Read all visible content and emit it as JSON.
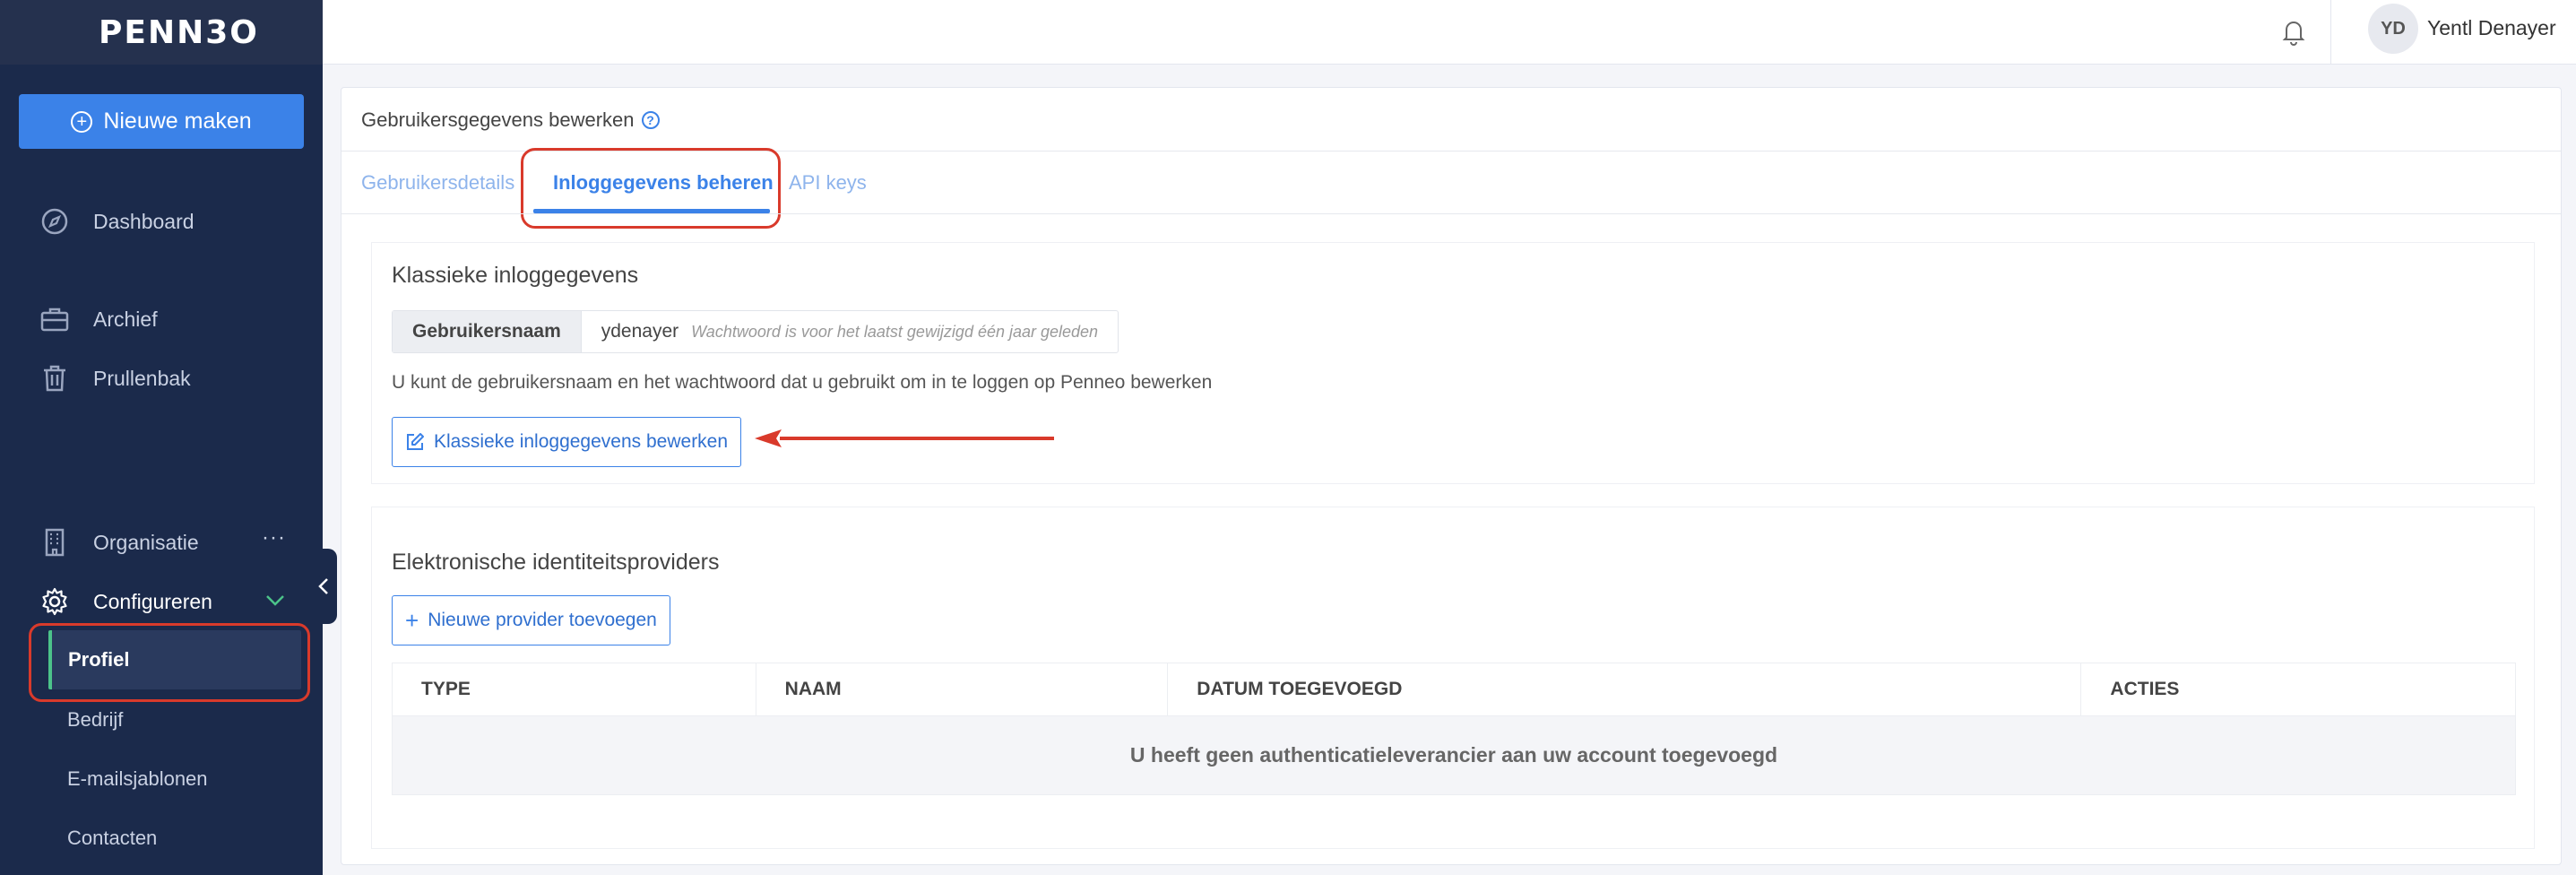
{
  "brand": {
    "logo_text": "PENN3O"
  },
  "sidebar": {
    "new_button_label": "Nieuwe maken",
    "items": [
      {
        "label": "Dashboard",
        "icon": "compass-icon"
      },
      {
        "label": "Archief",
        "icon": "briefcase-icon"
      },
      {
        "label": "Prullenbak",
        "icon": "trash-icon"
      },
      {
        "label": "Organisatie",
        "icon": "building-icon",
        "more": "···"
      },
      {
        "label": "Configureren",
        "icon": "gear-icon"
      }
    ],
    "sub_items": [
      "Profiel",
      "Bedrijf",
      "E-mailsjablonen",
      "Contacten"
    ],
    "collapse_icon": "chevron-left-icon"
  },
  "header": {
    "avatar_initials": "YD",
    "user_name": "Yentl Denayer",
    "bell_icon": "bell-icon"
  },
  "card": {
    "title": "Gebruikersgegevens bewerken",
    "help_glyph": "?",
    "tabs": [
      {
        "label": "Gebruikersdetails"
      },
      {
        "label": "Inloggegevens beheren"
      },
      {
        "label": "API keys"
      }
    ],
    "active_tab": "Inloggegevens beheren"
  },
  "classic": {
    "title": "Klassieke inloggegevens",
    "username_label": "Gebruikersnaam",
    "username_value": "ydenayer",
    "password_hint": "Wachtwoord is voor het laatst gewijzigd één jaar geleden",
    "description": "U kunt de gebruikersnaam en het wachtwoord dat u gebruikt om in te loggen op Penneo bewerken",
    "edit_button": "Klassieke inloggegevens bewerken"
  },
  "providers": {
    "title": "Elektronische identiteitsproviders",
    "add_button": "Nieuwe provider toevoegen",
    "columns": [
      "TYPE",
      "NAAM",
      "DATUM TOEGEVOEGD",
      "ACTIES"
    ],
    "empty_text": "U heeft geen authenticatieleverancier aan uw account toegevoegd"
  },
  "colors": {
    "accent": "#3b82e8",
    "sidebar": "#1b2a4b",
    "annotation": "#d93a2b",
    "active_marker": "#4cc38a"
  }
}
